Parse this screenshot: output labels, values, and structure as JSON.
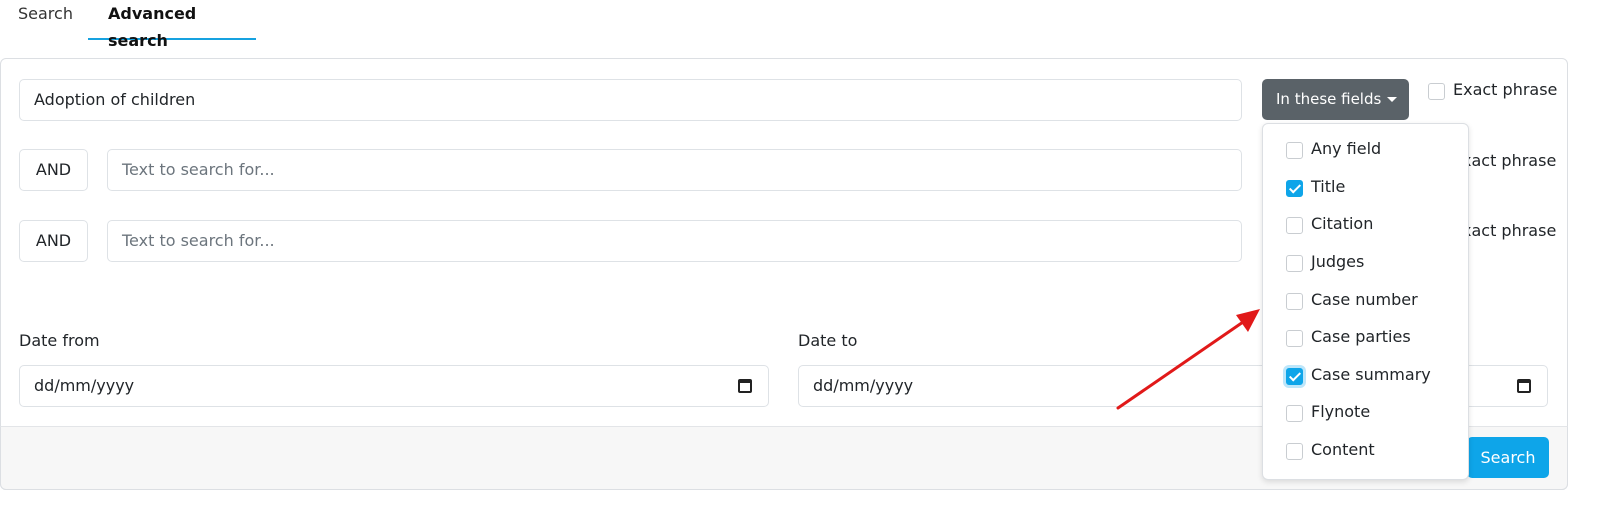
{
  "tabs": {
    "search": "Search",
    "advanced": "Advanced search"
  },
  "rows": [
    {
      "operator": "",
      "value": "Adoption of children",
      "placeholder": "",
      "exact_label": "Exact phrase"
    },
    {
      "operator": "AND",
      "value": "",
      "placeholder": "Text to search for...",
      "exact_label": "xact phrase"
    },
    {
      "operator": "AND",
      "value": "",
      "placeholder": "Text to search for...",
      "exact_label": "xact phrase"
    }
  ],
  "field_selector": {
    "label": "In these fields"
  },
  "field_options": [
    {
      "label": "Any field",
      "checked": false
    },
    {
      "label": "Title",
      "checked": true
    },
    {
      "label": "Citation",
      "checked": false
    },
    {
      "label": "Judges",
      "checked": false
    },
    {
      "label": "Case number",
      "checked": false
    },
    {
      "label": "Case parties",
      "checked": false
    },
    {
      "label": "Case summary",
      "checked": true
    },
    {
      "label": "Flynote",
      "checked": false
    },
    {
      "label": "Content",
      "checked": false
    }
  ],
  "date_from": {
    "label": "Date from",
    "placeholder": "dd/mm/yyyy"
  },
  "date_to": {
    "label": "Date to",
    "placeholder": "dd/mm/yyyy"
  },
  "search_button": {
    "label": "Search"
  },
  "colors": {
    "accent": "#0ea5e9",
    "dropdown_button": "#5a6268",
    "annotation_arrow": "#e11919"
  }
}
